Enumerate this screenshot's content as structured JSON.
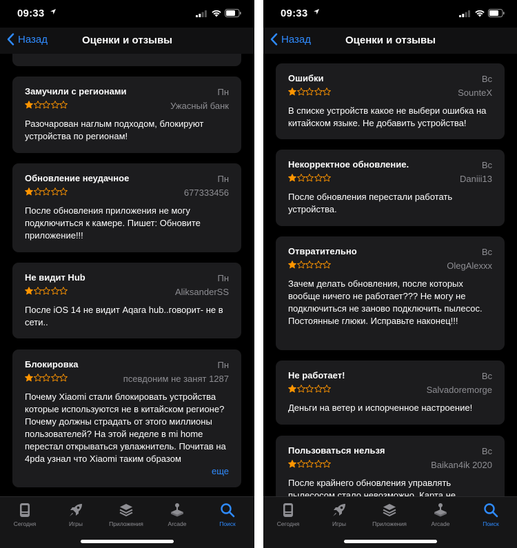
{
  "status": {
    "time": "09:33"
  },
  "nav": {
    "back_label": "Назад",
    "title": "Оценки и отзывы"
  },
  "tabs": [
    {
      "label": "Сегодня",
      "icon": "today-icon",
      "active": false
    },
    {
      "label": "Игры",
      "icon": "rocket-icon",
      "active": false
    },
    {
      "label": "Приложения",
      "icon": "apps-stack-icon",
      "active": false
    },
    {
      "label": "Arcade",
      "icon": "joystick-icon",
      "active": false
    },
    {
      "label": "Поиск",
      "icon": "search-icon",
      "active": true
    }
  ],
  "left": {
    "reviews": [
      {
        "title": "Замучили с регионами",
        "day": "Пн",
        "rating": 1,
        "author": "Ужасный банк",
        "body": "Разочарован наглым подходом, блокируют устройства по регионам!"
      },
      {
        "title": "Обновление неудачное",
        "day": "Пн",
        "rating": 1,
        "author": "677333456",
        "body": "После обновления приложения не могу подключиться к камере. Пишет: Обновите приложение!!!"
      },
      {
        "title": "Не видит Hub",
        "day": "Пн",
        "rating": 1,
        "author": "AliksanderSS",
        "body": "После iOS 14 не видит Aqara hub..говорит- не в сети.."
      },
      {
        "title": "Блокировка",
        "day": "Пн",
        "rating": 1,
        "author": "псевдоним не занят 1287",
        "body": "Почему Xiaomi стали блокировать устройства которые используются не в китайском регионе?\nПочему должны страдать от этого миллионы пользователей? На этой неделе в mi home перестал открываться увлажнитель. Почитав на 4pda узнал что Xiaomi таким образом",
        "more": "еще"
      }
    ]
  },
  "right": {
    "reviews": [
      {
        "title": "Ошибки",
        "day": "Вс",
        "rating": 1,
        "author": "SounteX",
        "body": "В списке устройств какое не выбери ошибка на китайском языке. Не добавить устройства!"
      },
      {
        "title": "Некорректное обновление.",
        "day": "Вс",
        "rating": 1,
        "author": "Daniii13",
        "body": "После обновления перестали работать устройства."
      },
      {
        "title": "Отвратительно",
        "day": "Вс",
        "rating": 1,
        "author": "OlegAlexxx",
        "body": "Зачем делать обновления, после которых вообще ничего не работает??? Не могу не подключиться не заново подключить пылесос. Постоянные глюки. Исправьте наконец!!!"
      },
      {
        "title": "Не работает!",
        "day": "Вс",
        "rating": 1,
        "author": "Salvadoremorge",
        "body": "Деньги на ветер и испорченное настроение!"
      },
      {
        "title": "Пользоваться нельзя",
        "day": "Вс",
        "rating": 1,
        "author": "Baikan4ik 2020",
        "body": "После крайнего обновления управлять пылесосом стало невозможно. Карта не"
      }
    ]
  },
  "colors": {
    "accent": "#2f8bff",
    "star": "#ff9500",
    "card": "#1c1c1e",
    "secondary": "#8e8e93"
  }
}
